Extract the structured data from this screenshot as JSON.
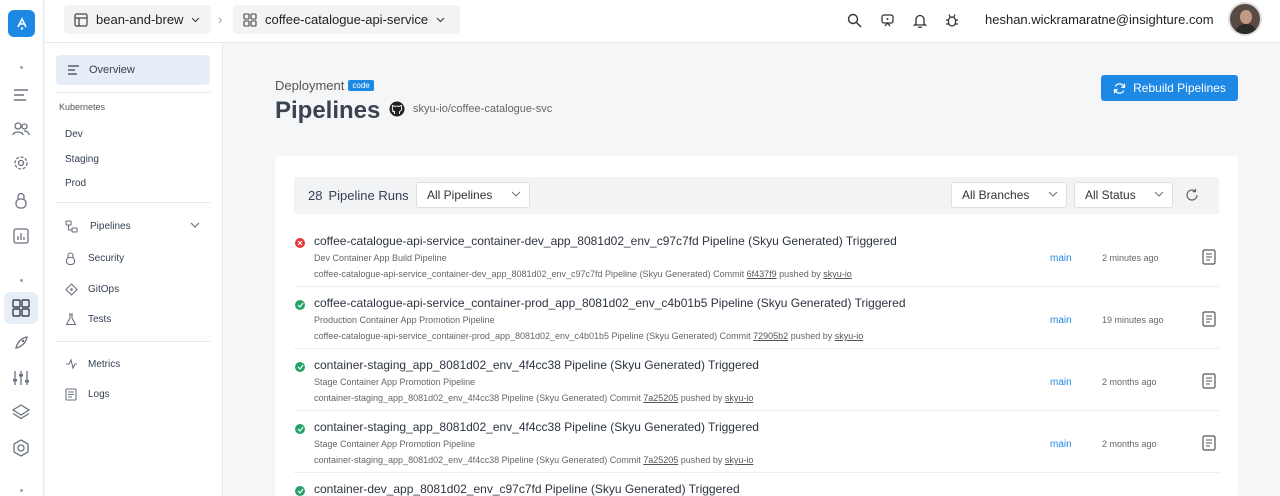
{
  "topbar": {
    "org": "bean-and-brew",
    "service": "coffee-catalogue-api-service",
    "email": "heshan.wickramaratne@insighture.com"
  },
  "sidebar": {
    "overview": "Overview",
    "kubernetes_heading": "Kubernetes",
    "environments": [
      "Dev",
      "Staging",
      "Prod"
    ],
    "pipelines": "Pipelines",
    "security": "Security",
    "gitops": "GitOps",
    "tests": "Tests",
    "metrics": "Metrics",
    "logs": "Logs"
  },
  "header": {
    "kicker": "Deployment",
    "badge": "code",
    "title": "Pipelines",
    "repo": "skyu-io/coffee-catalogue-svc",
    "rebuild_label": "Rebuild Pipelines"
  },
  "filters": {
    "count": "28",
    "runs_label": "Pipeline Runs",
    "pipelines_select": "All Pipelines",
    "branches_select": "All Branches",
    "status_select": "All Status"
  },
  "runs": [
    {
      "status": "failed",
      "title": "coffee-catalogue-api-service_container-dev_app_8081d02_env_c97c7fd Pipeline (Skyu Generated) Triggered",
      "subtitle": "Dev Container App Build Pipeline",
      "detail": "coffee-catalogue-api-service_container-dev_app_8081d02_env_c97c7fd Pipeline (Skyu Generated) Commit",
      "commit": "6f437f9",
      "pushed_by": "pushed by",
      "user": "skyu-io",
      "branch": "main",
      "time": "2 minutes ago"
    },
    {
      "status": "success",
      "title": "coffee-catalogue-api-service_container-prod_app_8081d02_env_c4b01b5 Pipeline (Skyu Generated) Triggered",
      "subtitle": "Production Container App Promotion Pipeline",
      "detail": "coffee-catalogue-api-service_container-prod_app_8081d02_env_c4b01b5 Pipeline (Skyu Generated) Commit",
      "commit": "72905b2",
      "pushed_by": "pushed by",
      "user": "skyu-io",
      "branch": "main",
      "time": "19 minutes ago"
    },
    {
      "status": "success",
      "title": "container-staging_app_8081d02_env_4f4cc38 Pipeline (Skyu Generated) Triggered",
      "subtitle": "Stage Container App Promotion Pipeline",
      "detail": "container-staging_app_8081d02_env_4f4cc38 Pipeline (Skyu Generated) Commit",
      "commit": "7a25205",
      "pushed_by": "pushed by",
      "user": "skyu-io",
      "branch": "main",
      "time": "2 months ago"
    },
    {
      "status": "success",
      "title": "container-staging_app_8081d02_env_4f4cc38 Pipeline (Skyu Generated) Triggered",
      "subtitle": "Stage Container App Promotion Pipeline",
      "detail": "container-staging_app_8081d02_env_4f4cc38 Pipeline (Skyu Generated) Commit",
      "commit": "7a25205",
      "pushed_by": "pushed by",
      "user": "skyu-io",
      "branch": "main",
      "time": "2 months ago"
    },
    {
      "status": "success",
      "title": "container-dev_app_8081d02_env_c97c7fd Pipeline (Skyu Generated) Triggered",
      "subtitle": "",
      "detail": "",
      "commit": "",
      "pushed_by": "",
      "user": "",
      "branch": "",
      "time": ""
    }
  ],
  "colors": {
    "accent": "#1e88e5",
    "success": "#26a269",
    "failed": "#e53935"
  }
}
